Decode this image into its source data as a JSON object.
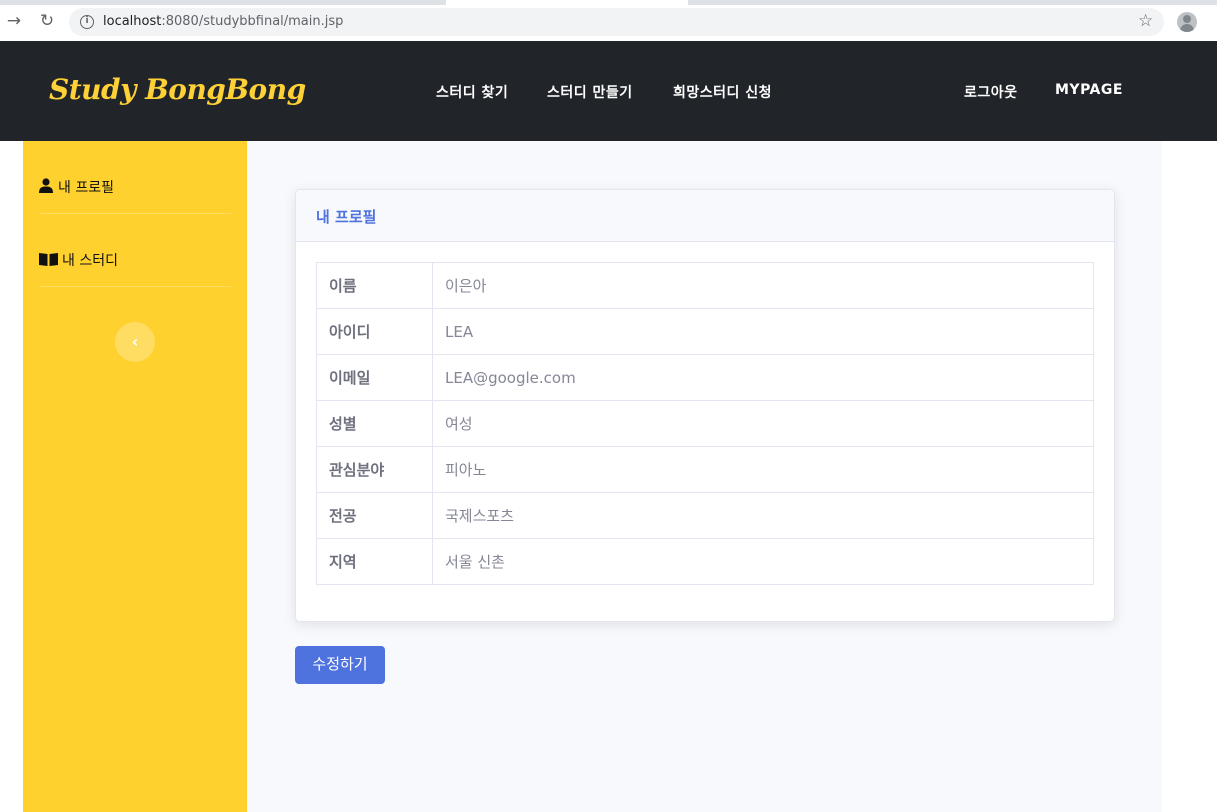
{
  "browser": {
    "url_host": "localhost",
    "url_path": ":8080/studybbfinal/main.jsp"
  },
  "header": {
    "brand": "Study BongBong",
    "nav": [
      "스터디 찾기",
      "스터디 만들기",
      "희망스터디 신청"
    ],
    "right_nav": [
      "로그아웃",
      "MYPAGE"
    ]
  },
  "sidebar": {
    "items": [
      {
        "icon": "user-icon",
        "label": "내 프로필"
      },
      {
        "icon": "book-icon",
        "label": "내 스터디"
      }
    ],
    "collapse_icon": "chevron-left-icon"
  },
  "profile_card": {
    "title": "내 프로필",
    "rows": [
      {
        "key": "이름",
        "value": "이은아"
      },
      {
        "key": "아이디",
        "value": "LEA"
      },
      {
        "key": "이메일",
        "value": "LEA@google.com"
      },
      {
        "key": "성별",
        "value": "여성"
      },
      {
        "key": "관심분야",
        "value": "피아노"
      },
      {
        "key": "전공",
        "value": "국제스포츠"
      },
      {
        "key": "지역",
        "value": "서울 신촌"
      }
    ]
  },
  "edit_button": "수정하기",
  "colors": {
    "header_bg": "#212529",
    "brand": "#fed136",
    "sidebar_bg": "#ffd12e",
    "accent": "#4e73df"
  }
}
